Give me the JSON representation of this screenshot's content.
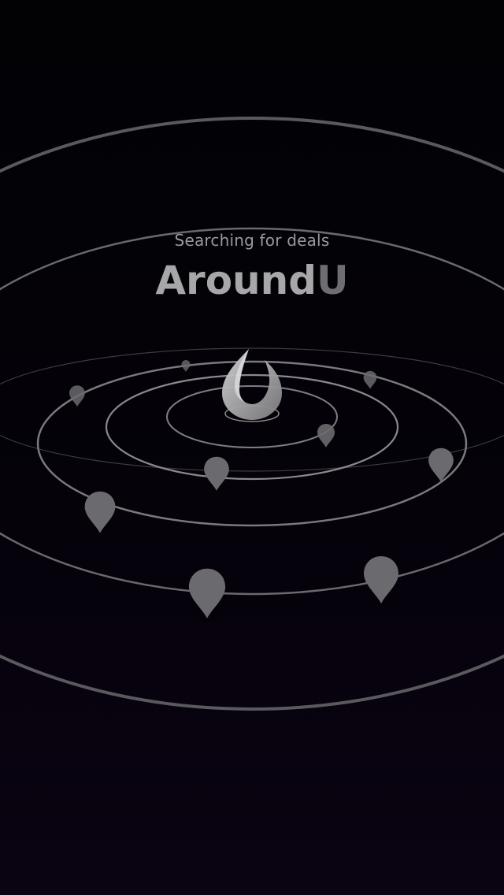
{
  "app": {
    "subtitle": "Searching for deals",
    "brand_main": "Around",
    "brand_accent": "U"
  },
  "colors": {
    "background_top": "#020104",
    "background_bottom": "#0a0312",
    "text_subtitle": "#9a9a9e",
    "brand_main": "#a7a7aa",
    "brand_accent": "#6e6e72",
    "ring": "#8a8a8e",
    "pin": "#6b6b6f"
  },
  "icons": {
    "logo": "drop-logo-icon",
    "pin": "map-pin-icon"
  }
}
